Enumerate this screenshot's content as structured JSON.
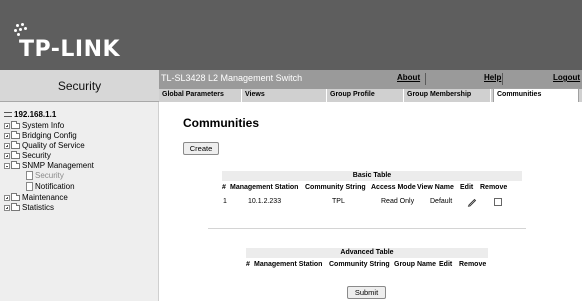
{
  "header": {
    "logo_text": "TP-LINK",
    "device_title": "TL-SL3428 L2 Management Switch",
    "links": [
      "About",
      "Help",
      "Logout"
    ]
  },
  "sidebar": {
    "title": "Security",
    "root": "192.168.1.1",
    "items": [
      {
        "label": "System Info",
        "icon": "folder-icon"
      },
      {
        "label": "Bridging Config",
        "icon": "folder-icon"
      },
      {
        "label": "Quality of Service",
        "icon": "folder-icon"
      },
      {
        "label": "Security",
        "icon": "folder-icon"
      },
      {
        "label": "SNMP Management",
        "icon": "folder-icon",
        "expanded": true,
        "children": [
          {
            "label": "Security",
            "icon": "page-icon"
          },
          {
            "label": "Notification",
            "icon": "page-icon"
          }
        ]
      },
      {
        "label": "Maintenance",
        "icon": "folder-icon"
      },
      {
        "label": "Statistics",
        "icon": "folder-icon"
      }
    ]
  },
  "tabs": [
    {
      "label": "Global Parameters"
    },
    {
      "label": "Views"
    },
    {
      "label": "Group Profile"
    },
    {
      "label": "Group Membership"
    },
    {
      "label": "Communities",
      "active": true
    }
  ],
  "main": {
    "title": "Communities",
    "create_label": "Create",
    "submit_label": "Submit",
    "basic_table": {
      "title": "Basic Table",
      "columns": [
        "#",
        "Management Station",
        "Community String",
        "Access Mode",
        "View Name",
        "Edit",
        "Remove"
      ],
      "rows": [
        {
          "num": "1",
          "station": "10.1.2.233",
          "community": "TPL",
          "access": "Read Only",
          "view": "Default",
          "edit": "pencil-icon",
          "remove": "checkbox-unchecked"
        }
      ]
    },
    "advanced_table": {
      "title": "Advanced Table",
      "columns": [
        "#",
        "Management Station",
        "Community String",
        "Group Name",
        "Edit",
        "Remove"
      ]
    }
  },
  "colors": {
    "banner": "#5e5e5e",
    "subbar": "#9a9a9a",
    "sidebar": "#eeeeee",
    "tabs": "#d0d0d0"
  }
}
